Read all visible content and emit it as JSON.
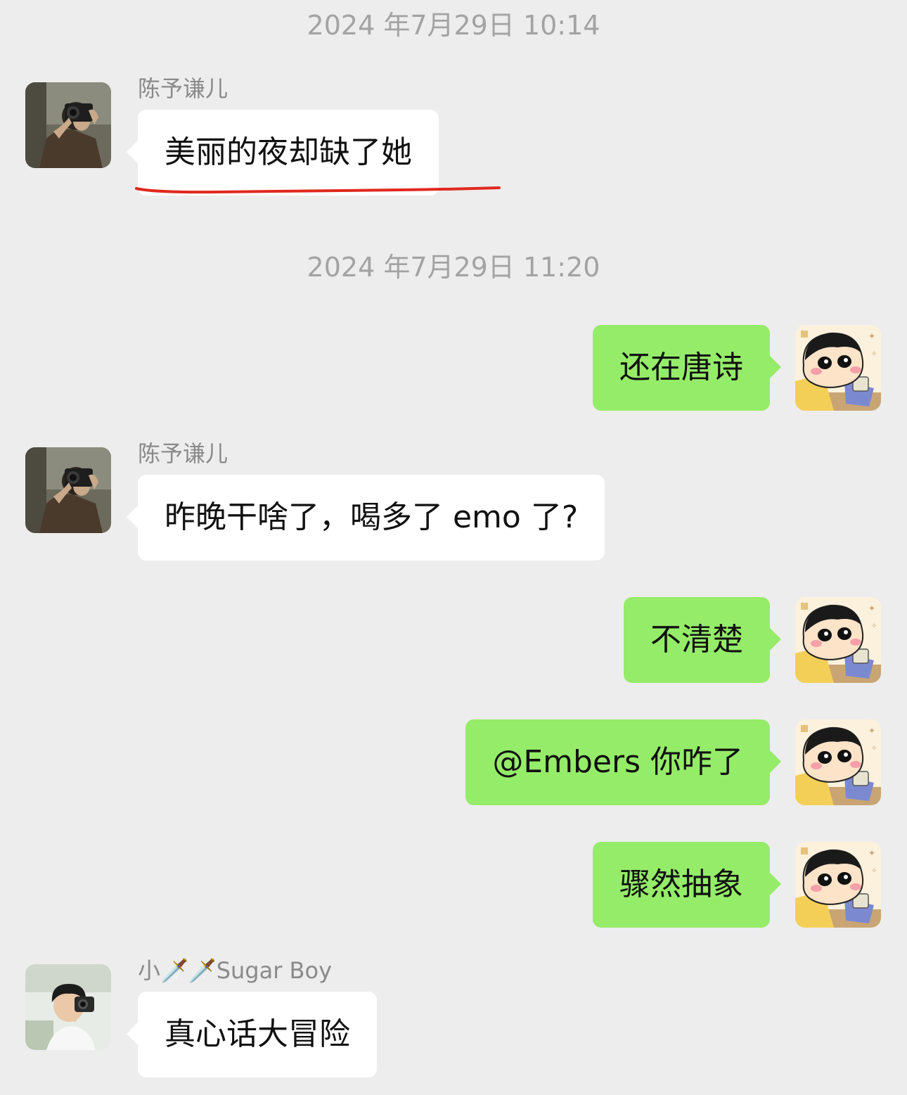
{
  "accent_colors": {
    "background": "#ededed",
    "incoming_bubble": "#ffffff",
    "outgoing_bubble": "#95ec69",
    "timestamp_text": "#a3a3a3",
    "name_text": "#8a8a8a",
    "underline_mark": "#e0281e"
  },
  "chat": {
    "timestamps": [
      "2024 年7月29日 10:14",
      "2024 年7月29日 11:20"
    ],
    "messages": [
      {
        "direction": "incoming",
        "sender": "陈予谦儿",
        "text": "美丽的夜却缺了她",
        "avatar_icon": "photographer-avatar-icon",
        "annotation": "red-underline"
      },
      {
        "direction": "outgoing",
        "text": "还在唐诗",
        "avatar_icon": "crayon-shinchan-avatar-icon"
      },
      {
        "direction": "incoming",
        "sender": "陈予谦儿",
        "text": "昨晚干啥了，喝多了 emo 了?",
        "avatar_icon": "photographer-avatar-icon"
      },
      {
        "direction": "outgoing",
        "text": "不清楚",
        "avatar_icon": "crayon-shinchan-avatar-icon"
      },
      {
        "direction": "outgoing",
        "text": "@Embers 你咋了",
        "avatar_icon": "crayon-shinchan-avatar-icon"
      },
      {
        "direction": "outgoing",
        "text": "骤然抽象",
        "avatar_icon": "crayon-shinchan-avatar-icon"
      },
      {
        "direction": "incoming",
        "sender": "小🗡️🗡️Sugar Boy",
        "text": "真心话大冒险",
        "avatar_icon": "boy-camera-avatar-icon"
      }
    ]
  }
}
